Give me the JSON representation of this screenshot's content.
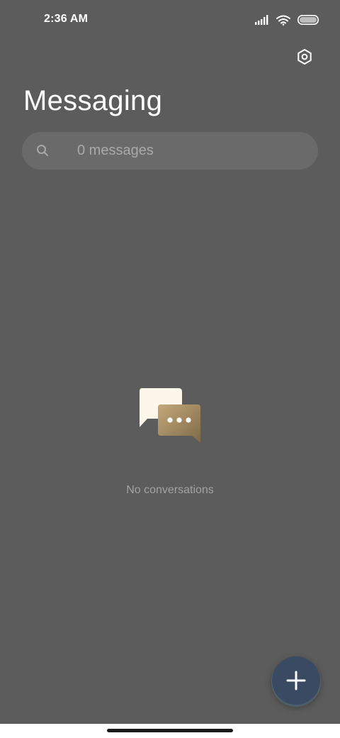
{
  "status_bar": {
    "time": "2:36 AM",
    "icons": [
      "signal-icon",
      "wifi-icon",
      "battery-icon"
    ]
  },
  "header": {
    "title": "Messaging",
    "settings_icon": "settings-icon"
  },
  "search": {
    "placeholder": "0 messages",
    "value": "",
    "icon": "search-icon"
  },
  "empty_state": {
    "illustration": "chat-bubbles-icon",
    "message": "No conversations"
  },
  "fab": {
    "icon": "plus-icon"
  },
  "colors": {
    "background": "#5c5c5c",
    "search_bg": "#6a6a6a",
    "fab_bg": "#3b4a63",
    "text_primary": "#ffffff",
    "text_muted": "#a3a3a3"
  }
}
